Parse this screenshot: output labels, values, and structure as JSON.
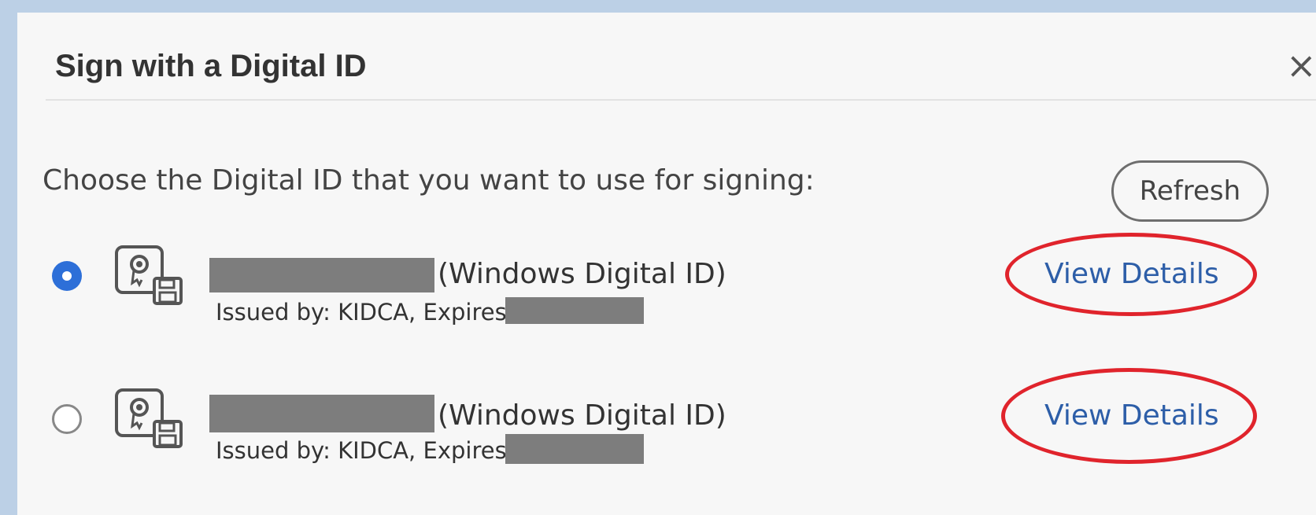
{
  "dialog": {
    "title": "Sign with a Digital ID",
    "close_symbol": "×",
    "prompt": "Choose the Digital ID that you want to use for signing:",
    "refresh_label": "Refresh"
  },
  "ids": [
    {
      "selected": true,
      "name_suffix": "(Windows Digital ID)",
      "issuer": "Issued by: KIDCA, Expires:",
      "view_label": "View Details",
      "icon": "certificate-icon"
    },
    {
      "selected": false,
      "name_suffix": "(Windows Digital ID)",
      "issuer": "Issued by: KIDCA, Expires:",
      "view_label": "View Details",
      "icon": "certificate-icon"
    }
  ],
  "colors": {
    "accent": "#2d6fd8",
    "link": "#2d5ea8",
    "annotation": "#e0242c"
  }
}
